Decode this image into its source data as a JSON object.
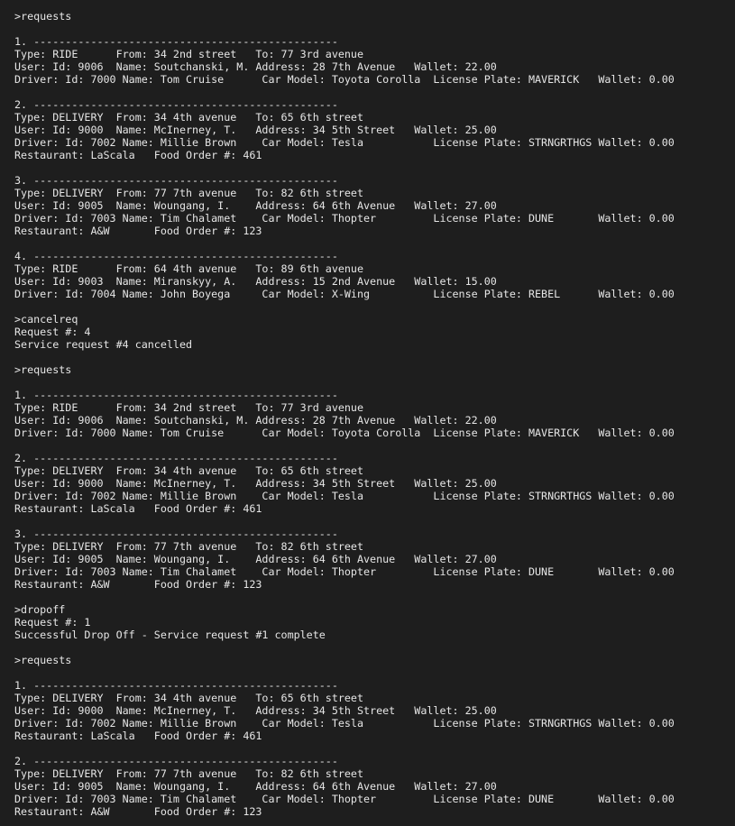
{
  "terminal": {
    "lines": [
      ">requests",
      "",
      "1. ------------------------------------------------",
      "Type: RIDE      From: 34 2nd street   To: 77 3rd avenue",
      "User: Id: 9006  Name: Soutchanski, M. Address: 28 7th Avenue   Wallet: 22.00",
      "Driver: Id: 7000 Name: Tom Cruise      Car Model: Toyota Corolla  License Plate: MAVERICK   Wallet: 0.00",
      "",
      "2. ------------------------------------------------",
      "Type: DELIVERY  From: 34 4th avenue   To: 65 6th street",
      "User: Id: 9000  Name: McInerney, T.   Address: 34 5th Street   Wallet: 25.00",
      "Driver: Id: 7002 Name: Millie Brown    Car Model: Tesla           License Plate: STRNGRTHGS Wallet: 0.00",
      "Restaurant: LaScala   Food Order #: 461",
      "",
      "3. ------------------------------------------------",
      "Type: DELIVERY  From: 77 7th avenue   To: 82 6th street",
      "User: Id: 9005  Name: Woungang, I.    Address: 64 6th Avenue   Wallet: 27.00",
      "Driver: Id: 7003 Name: Tim Chalamet    Car Model: Thopter         License Plate: DUNE       Wallet: 0.00",
      "Restaurant: A&W       Food Order #: 123",
      "",
      "4. ------------------------------------------------",
      "Type: RIDE      From: 64 4th avenue   To: 89 6th avenue",
      "User: Id: 9003  Name: Miranskyy, A.   Address: 15 2nd Avenue   Wallet: 15.00",
      "Driver: Id: 7004 Name: John Boyega     Car Model: X-Wing          License Plate: REBEL      Wallet: 0.00",
      "",
      ">cancelreq",
      "Request #: 4",
      "Service request #4 cancelled",
      "",
      ">requests",
      "",
      "1. ------------------------------------------------",
      "Type: RIDE      From: 34 2nd street   To: 77 3rd avenue",
      "User: Id: 9006  Name: Soutchanski, M. Address: 28 7th Avenue   Wallet: 22.00",
      "Driver: Id: 7000 Name: Tom Cruise      Car Model: Toyota Corolla  License Plate: MAVERICK   Wallet: 0.00",
      "",
      "2. ------------------------------------------------",
      "Type: DELIVERY  From: 34 4th avenue   To: 65 6th street",
      "User: Id: 9000  Name: McInerney, T.   Address: 34 5th Street   Wallet: 25.00",
      "Driver: Id: 7002 Name: Millie Brown    Car Model: Tesla           License Plate: STRNGRTHGS Wallet: 0.00",
      "Restaurant: LaScala   Food Order #: 461",
      "",
      "3. ------------------------------------------------",
      "Type: DELIVERY  From: 77 7th avenue   To: 82 6th street",
      "User: Id: 9005  Name: Woungang, I.    Address: 64 6th Avenue   Wallet: 27.00",
      "Driver: Id: 7003 Name: Tim Chalamet    Car Model: Thopter         License Plate: DUNE       Wallet: 0.00",
      "Restaurant: A&W       Food Order #: 123",
      "",
      ">dropoff",
      "Request #: 1",
      "Successful Drop Off - Service request #1 complete",
      "",
      ">requests",
      "",
      "1. ------------------------------------------------",
      "Type: DELIVERY  From: 34 4th avenue   To: 65 6th street",
      "User: Id: 9000  Name: McInerney, T.   Address: 34 5th Street   Wallet: 25.00",
      "Driver: Id: 7002 Name: Millie Brown    Car Model: Tesla           License Plate: STRNGRTHGS Wallet: 0.00",
      "Restaurant: LaScala   Food Order #: 461",
      "",
      "2. ------------------------------------------------",
      "Type: DELIVERY  From: 77 7th avenue   To: 82 6th street",
      "User: Id: 9005  Name: Woungang, I.    Address: 64 6th Avenue   Wallet: 27.00",
      "Driver: Id: 7003 Name: Tim Chalamet    Car Model: Thopter         License Plate: DUNE       Wallet: 0.00",
      "Restaurant: A&W       Food Order #: 123"
    ]
  }
}
